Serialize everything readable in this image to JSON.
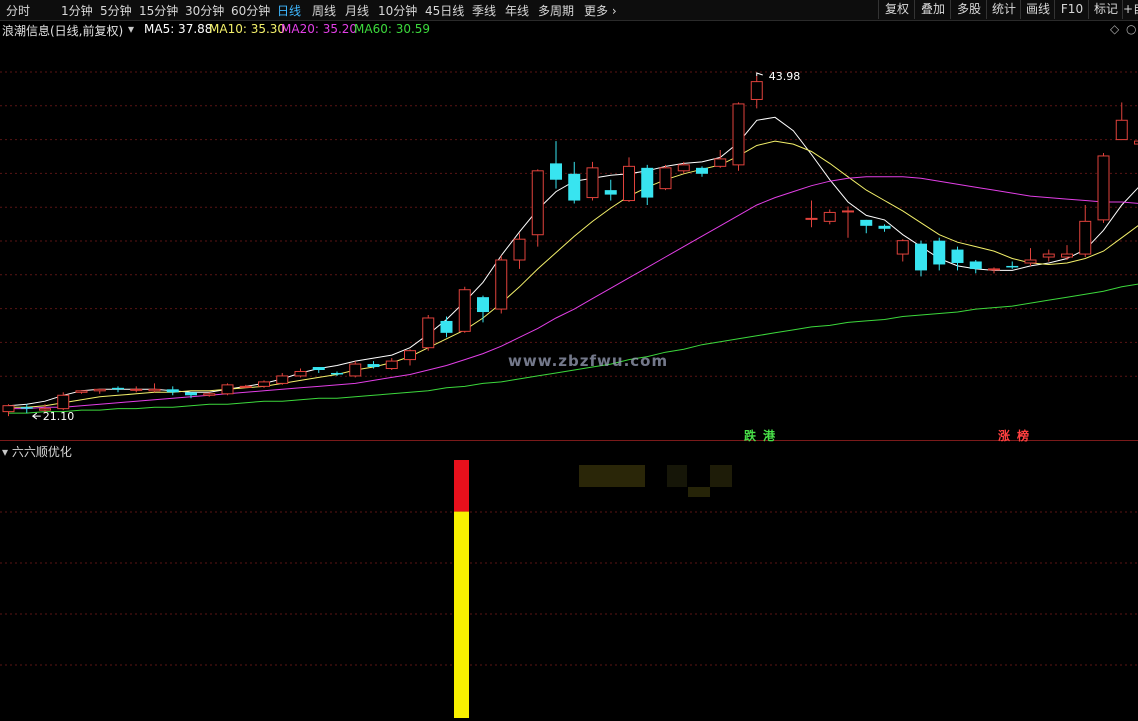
{
  "toolbar": {
    "timeframes": [
      "分时",
      "1分钟",
      "5分钟",
      "15分钟",
      "30分钟",
      "60分钟",
      "日线",
      "周线",
      "月线",
      "10分钟",
      "45日线",
      "季线",
      "年线",
      "多周期",
      "更多"
    ],
    "active": "日线",
    "right_buttons": [
      "复权",
      "叠加",
      "多股",
      "统计",
      "画线",
      "F10",
      "标记",
      "+自"
    ]
  },
  "info": {
    "stock_title": "浪潮信息(日线,前复权)",
    "ma5": "MA5: 37.88",
    "ma10": "MA10: 35.30",
    "ma20": "MA20: 35.20",
    "ma60": "MA60: 30.59"
  },
  "colors": {
    "up": "#e0423c",
    "down": "#38e4f0",
    "ma5": "#ffffff",
    "ma10": "#f3f06a",
    "ma20": "#e23fe6",
    "ma60": "#3cd83c",
    "grid": "#5a1414",
    "volume_top": "#e8101c",
    "volume_body": "#f8f000"
  },
  "indicator": {
    "title": "六六顺优化",
    "bar_red_fraction": 0.2
  },
  "markers": {
    "fall": [
      "跌",
      "港"
    ],
    "rise": [
      "涨",
      "榜"
    ]
  },
  "watermark": "www.zbzfwu.com",
  "chart_data": {
    "type": "candlestick",
    "high_label": "43.98",
    "low_label": "21.10",
    "ylim": [
      20.5,
      46.4
    ],
    "candles": [
      [
        21.4,
        21.8,
        21.9,
        21.1
      ],
      [
        21.7,
        21.6,
        21.9,
        21.3
      ],
      [
        21.5,
        21.6,
        21.9,
        21.3
      ],
      [
        21.6,
        22.5,
        22.7,
        21.5
      ],
      [
        22.7,
        22.8,
        22.8,
        22.6
      ],
      [
        22.8,
        22.9,
        22.9,
        22.6
      ],
      [
        23.0,
        22.9,
        23.1,
        22.7
      ],
      [
        22.9,
        22.9,
        23.1,
        22.7
      ],
      [
        22.8,
        22.9,
        23.3,
        22.7
      ],
      [
        22.9,
        22.7,
        23.1,
        22.5
      ],
      [
        22.7,
        22.5,
        22.7,
        22.3
      ],
      [
        22.5,
        22.6,
        22.7,
        22.4
      ],
      [
        22.6,
        23.2,
        23.3,
        22.5
      ],
      [
        23.1,
        23.1,
        23.2,
        23.0
      ],
      [
        23.1,
        23.4,
        23.5,
        23.0
      ],
      [
        23.3,
        23.8,
        24.0,
        23.2
      ],
      [
        23.8,
        24.1,
        24.3,
        23.7
      ],
      [
        24.4,
        24.2,
        24.4,
        24.0
      ],
      [
        24.0,
        23.9,
        24.1,
        23.8
      ],
      [
        23.8,
        24.6,
        24.8,
        23.7
      ],
      [
        24.6,
        24.4,
        24.8,
        24.3
      ],
      [
        24.3,
        24.8,
        25.0,
        24.2
      ],
      [
        24.9,
        25.5,
        25.6,
        24.5
      ],
      [
        25.7,
        27.7,
        27.9,
        25.5
      ],
      [
        27.5,
        26.7,
        27.8,
        26.4
      ],
      [
        26.8,
        29.6,
        29.8,
        26.7
      ],
      [
        29.1,
        28.1,
        29.2,
        27.4
      ],
      [
        28.3,
        31.6,
        31.9,
        28.0
      ],
      [
        31.6,
        33.0,
        33.4,
        31.0
      ],
      [
        33.3,
        37.6,
        37.7,
        32.5
      ],
      [
        38.1,
        37.0,
        39.6,
        36.4
      ],
      [
        37.4,
        35.6,
        38.2,
        35.4
      ],
      [
        35.8,
        37.8,
        38.2,
        35.6
      ],
      [
        36.3,
        36.0,
        37.0,
        35.6
      ],
      [
        35.6,
        37.9,
        38.5,
        35.5
      ],
      [
        37.8,
        35.8,
        38.0,
        35.3
      ],
      [
        36.4,
        37.8,
        38.0,
        36.3
      ],
      [
        37.6,
        38.0,
        38.2,
        37.4
      ],
      [
        37.8,
        37.4,
        37.9,
        37.2
      ],
      [
        37.9,
        38.4,
        39.0,
        37.8
      ],
      [
        38.0,
        42.1,
        42.2,
        37.6
      ],
      [
        42.4,
        43.6,
        43.98,
        41.8
      ],
      [
        0,
        0,
        0,
        0
      ],
      [
        0,
        0,
        0,
        0
      ],
      [
        34.4,
        34.4,
        35.6,
        33.8
      ],
      [
        34.2,
        34.8,
        35.0,
        34.0
      ],
      [
        34.9,
        34.9,
        35.2,
        33.1
      ],
      [
        34.3,
        33.9,
        34.3,
        33.4
      ],
      [
        33.9,
        33.7,
        34.0,
        33.5
      ],
      [
        32.0,
        32.9,
        33.0,
        31.5
      ],
      [
        32.7,
        30.9,
        32.9,
        30.5
      ],
      [
        32.9,
        31.3,
        33.1,
        30.9
      ],
      [
        32.3,
        31.4,
        32.5,
        30.9
      ],
      [
        31.5,
        31.0,
        31.6,
        30.7
      ],
      [
        31.0,
        31.0,
        31.1,
        30.7
      ],
      [
        31.2,
        31.1,
        31.5,
        31.0
      ],
      [
        31.4,
        31.6,
        32.4,
        31.2
      ],
      [
        31.8,
        32.0,
        32.3,
        31.5
      ],
      [
        31.8,
        32.0,
        32.6,
        31.6
      ],
      [
        32.0,
        34.2,
        35.3,
        31.8
      ],
      [
        34.3,
        38.6,
        38.8,
        34.1
      ],
      [
        39.7,
        41.0,
        42.2,
        39.7
      ],
      [
        39.4,
        39.6,
        40.3,
        38.4
      ],
      [
        37.8,
        35.4,
        38.1,
        35.2
      ],
      [
        36.0,
        36.6,
        37.1,
        35.6
      ],
      [
        0,
        0,
        0,
        0
      ]
    ],
    "ma_series": {
      "ma5": [
        21.8,
        21.9,
        22.1,
        22.5,
        22.8,
        22.9,
        22.9,
        22.9,
        22.9,
        22.8,
        22.7,
        22.7,
        22.9,
        23.1,
        23.3,
        23.6,
        24.0,
        24.3,
        24.5,
        24.8,
        25.0,
        25.2,
        25.7,
        26.6,
        27.6,
        28.8,
        30.1,
        31.9,
        33.5,
        35.0,
        36.2,
        36.9,
        37.1,
        37.3,
        37.4,
        37.6,
        37.9,
        38.1,
        38.2,
        38.5,
        39.5,
        41.0,
        41.2,
        40.3,
        38.7,
        37.0,
        35.5,
        34.6,
        34.3,
        33.3,
        32.5,
        31.7,
        31.2,
        31.0,
        30.9,
        30.9,
        31.2,
        31.4,
        31.7,
        32.3,
        33.6,
        35.3,
        36.6,
        37.3,
        37.88,
        37.88
      ],
      "ma10": [
        21.7,
        21.7,
        21.8,
        22.0,
        22.2,
        22.4,
        22.5,
        22.6,
        22.7,
        22.7,
        22.8,
        22.8,
        22.9,
        23.0,
        23.1,
        23.3,
        23.5,
        23.7,
        23.9,
        24.2,
        24.4,
        24.7,
        25.1,
        25.7,
        26.3,
        26.9,
        27.7,
        28.7,
        29.8,
        31.0,
        32.1,
        33.2,
        34.2,
        35.1,
        35.9,
        36.5,
        37.0,
        37.4,
        37.7,
        38.0,
        38.6,
        39.3,
        39.6,
        39.4,
        38.9,
        38.1,
        37.2,
        36.3,
        35.6,
        34.9,
        34.1,
        33.3,
        32.8,
        32.5,
        32.2,
        31.7,
        31.4,
        31.3,
        31.4,
        31.7,
        32.2,
        33.1,
        34.0,
        34.8,
        35.3,
        35.3
      ],
      "ma20": [
        21.6,
        21.6,
        21.7,
        21.7,
        21.8,
        21.9,
        22.0,
        22.1,
        22.2,
        22.3,
        22.4,
        22.5,
        22.6,
        22.7,
        22.8,
        22.9,
        23.0,
        23.1,
        23.2,
        23.3,
        23.5,
        23.7,
        23.9,
        24.2,
        24.5,
        24.9,
        25.3,
        25.8,
        26.4,
        27.0,
        27.7,
        28.3,
        29.0,
        29.7,
        30.4,
        31.1,
        31.8,
        32.5,
        33.2,
        33.9,
        34.6,
        35.3,
        35.8,
        36.2,
        36.6,
        36.9,
        37.1,
        37.2,
        37.2,
        37.2,
        37.1,
        36.9,
        36.7,
        36.5,
        36.3,
        36.1,
        35.9,
        35.8,
        35.7,
        35.6,
        35.5,
        35.5,
        35.4,
        35.3,
        35.2,
        35.2
      ],
      "ma60": [
        21.3,
        21.3,
        21.4,
        21.4,
        21.5,
        21.5,
        21.6,
        21.6,
        21.7,
        21.7,
        21.8,
        21.9,
        21.9,
        22.0,
        22.1,
        22.1,
        22.2,
        22.3,
        22.3,
        22.4,
        22.5,
        22.6,
        22.7,
        22.8,
        23.0,
        23.1,
        23.3,
        23.4,
        23.6,
        23.8,
        24.0,
        24.2,
        24.4,
        24.6,
        24.9,
        25.1,
        25.4,
        25.6,
        25.9,
        26.1,
        26.3,
        26.5,
        26.7,
        26.9,
        27.1,
        27.2,
        27.4,
        27.5,
        27.6,
        27.8,
        27.9,
        28.0,
        28.1,
        28.3,
        28.4,
        28.5,
        28.7,
        28.9,
        29.1,
        29.3,
        29.5,
        29.8,
        30.0,
        30.3,
        30.59,
        30.59
      ]
    }
  }
}
